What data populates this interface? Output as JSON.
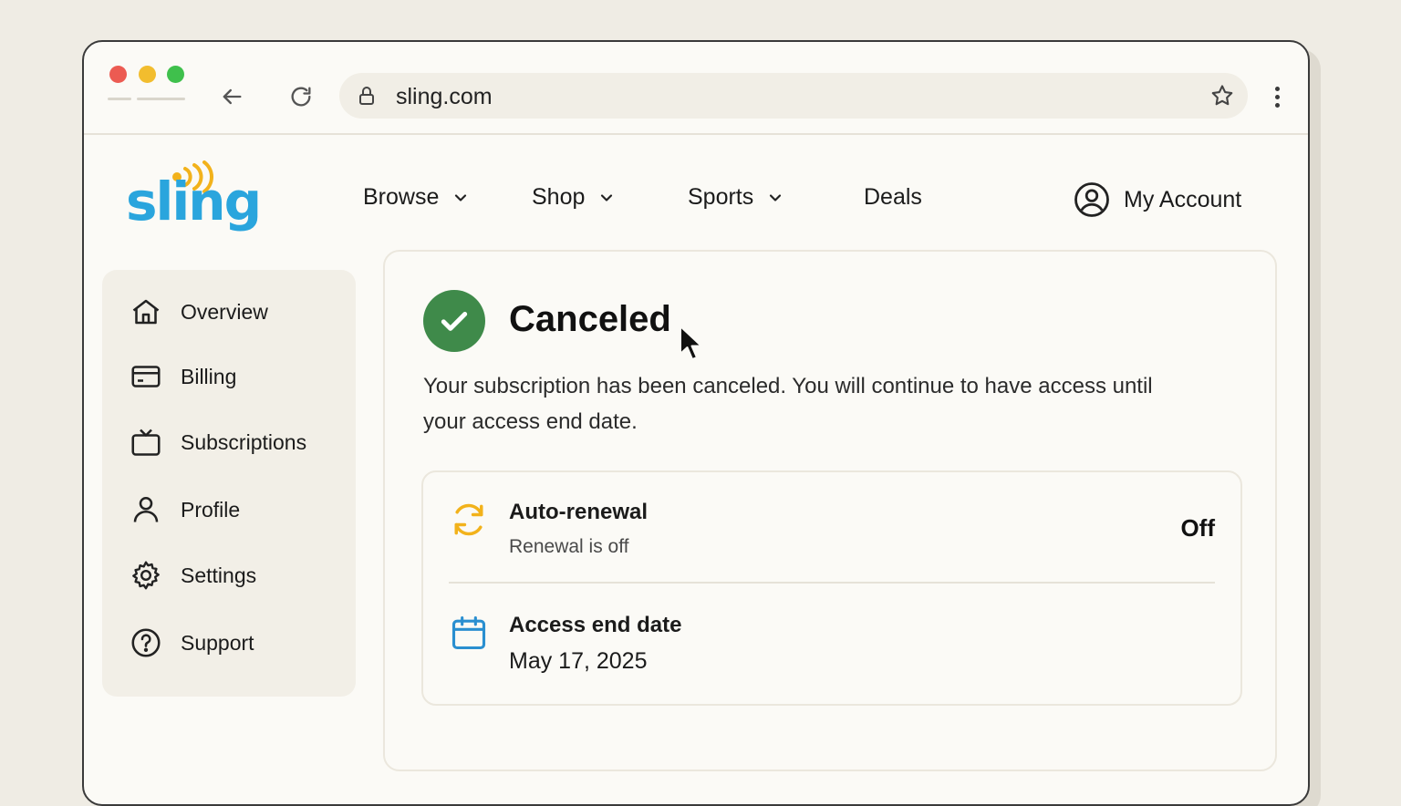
{
  "browser": {
    "url": "sling.com"
  },
  "brand": {
    "logo_text": "sling",
    "logo_color": "#2aa5dd",
    "logo_accent_color": "#f2b21b"
  },
  "topnav": {
    "items": [
      {
        "label": "Browse",
        "has_dropdown": true
      },
      {
        "label": "Shop",
        "has_dropdown": true
      },
      {
        "label": "Sports",
        "has_dropdown": true
      },
      {
        "label": "Deals",
        "has_dropdown": false
      }
    ],
    "account_label": "My Account"
  },
  "sidebar": {
    "items": [
      {
        "label": "Overview",
        "icon": "home-icon"
      },
      {
        "label": "Billing",
        "icon": "credit-card-icon"
      },
      {
        "label": "Subscriptions",
        "icon": "tv-icon"
      },
      {
        "label": "Profile",
        "icon": "user-icon"
      },
      {
        "label": "Settings",
        "icon": "gear-icon"
      },
      {
        "label": "Support",
        "icon": "help-circle-icon"
      }
    ]
  },
  "status": {
    "title": "Canceled",
    "color": "#3f8a4a",
    "description": "Your subscription has been canceled. You will continue to have access until your access end date."
  },
  "details": {
    "auto_renewal": {
      "title": "Auto-renewal",
      "subtitle": "Renewal is off",
      "value": "Off",
      "icon": "refresh-icon",
      "icon_color": "#f2b21b"
    },
    "access_end": {
      "title": "Access end date",
      "value": "May 17, 2025",
      "icon": "calendar-icon",
      "icon_color": "#2a8fd0"
    }
  }
}
